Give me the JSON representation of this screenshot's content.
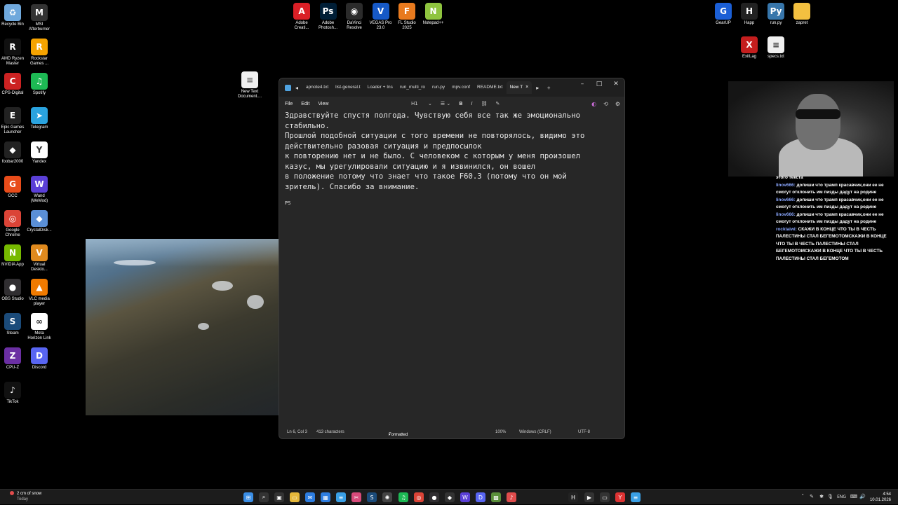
{
  "desktop": {
    "icons_left": [
      {
        "label": "Recycle Bin",
        "icon": "recycle-bin-icon",
        "color": "#6fa8dc",
        "glyph": "♻"
      },
      {
        "label": "MSI\nAfterburner",
        "icon": "msi-afterburner-icon",
        "color": "#333333",
        "glyph": "M"
      },
      {
        "label": "AMD Ryzen\nMaster",
        "icon": "amd-ryzen-master-icon",
        "color": "#111111",
        "glyph": "R"
      },
      {
        "label": "Rockstar\nGames ...",
        "icon": "rockstar-games-icon",
        "color": "#f5a300",
        "glyph": "R"
      },
      {
        "label": "CPS-Digital",
        "icon": "cps-digital-icon",
        "color": "#cc2222",
        "glyph": "C"
      },
      {
        "label": "Spotify",
        "icon": "spotify-icon",
        "color": "#1db954",
        "glyph": "♫"
      },
      {
        "label": "Epic Games\nLauncher",
        "icon": "epic-games-icon",
        "color": "#222222",
        "glyph": "E"
      },
      {
        "label": "Telegram",
        "icon": "telegram-icon",
        "color": "#2aa3df",
        "glyph": "➤"
      },
      {
        "label": "foobar2000",
        "icon": "foobar2000-icon",
        "color": "#222222",
        "glyph": "◆"
      },
      {
        "label": "Yandex",
        "icon": "yandex-icon",
        "color": "#ffffff",
        "glyph": "Y"
      },
      {
        "label": "GCC",
        "icon": "gcc-icon",
        "color": "#e84c1a",
        "glyph": "G"
      },
      {
        "label": "Wand\n(WeMod)",
        "icon": "wand-icon",
        "color": "#5a3fd6",
        "glyph": "W"
      },
      {
        "label": "Google\nChrome",
        "icon": "chrome-icon",
        "color": "#db4437",
        "glyph": "◎"
      },
      {
        "label": "CrystalDisk...",
        "icon": "crystaldisk-icon",
        "color": "#5a8fd6",
        "glyph": "◆"
      },
      {
        "label": "NVIDIA App",
        "icon": "nvidia-icon",
        "color": "#76b900",
        "glyph": "N"
      },
      {
        "label": "Virtual\nDeskto...",
        "icon": "virtual-desktop-icon",
        "color": "#e08a1e",
        "glyph": "V"
      },
      {
        "label": "OBS Studio",
        "icon": "obs-icon",
        "color": "#302e31",
        "glyph": "●"
      },
      {
        "label": "VLC media\nplayer",
        "icon": "vlc-icon",
        "color": "#f07a00",
        "glyph": "▲"
      },
      {
        "label": "Steam",
        "icon": "steam-icon",
        "color": "#1b4b7a",
        "glyph": "S"
      },
      {
        "label": "Meta\nHorizon Link",
        "icon": "meta-horizon-icon",
        "color": "#ffffff",
        "glyph": "∞"
      },
      {
        "label": "CPU-Z",
        "icon": "cpu-z-icon",
        "color": "#6b2fa3",
        "glyph": "Z"
      },
      {
        "label": "Discord",
        "icon": "discord-icon",
        "color": "#5865f2",
        "glyph": "D"
      },
      {
        "label": "TikTok",
        "icon": "tiktok-icon",
        "color": "#111111",
        "glyph": "♪"
      }
    ],
    "icons_top": [
      {
        "label": "Adobe\nCreati...",
        "icon": "adobe-cc-icon",
        "color": "#da1f26",
        "glyph": "A"
      },
      {
        "label": "Adobe\nPhotosh...",
        "icon": "photoshop-icon",
        "color": "#001e36",
        "glyph": "Ps"
      },
      {
        "label": "DaVinci\nResolve",
        "icon": "davinci-resolve-icon",
        "color": "#2b2b2b",
        "glyph": "◉"
      },
      {
        "label": "VEGAS Pro\n23.0",
        "icon": "vegas-pro-icon",
        "color": "#1659c7",
        "glyph": "V"
      },
      {
        "label": "FL Studio\n2025",
        "icon": "fl-studio-icon",
        "color": "#e87a1e",
        "glyph": "F"
      },
      {
        "label": "Notepad++",
        "icon": "notepadpp-icon",
        "color": "#8fc43f",
        "glyph": "N"
      }
    ],
    "icons_right": [
      {
        "label": "GearUP",
        "icon": "gearup-icon",
        "color": "#1b5fd6",
        "glyph": "G"
      },
      {
        "label": "Happ",
        "icon": "happ-icon",
        "color": "#222222",
        "glyph": "H"
      },
      {
        "label": "run.py",
        "icon": "python-file-icon",
        "color": "#3776ab",
        "glyph": "Py"
      },
      {
        "label": "zapret",
        "icon": "folder-icon",
        "color": "#f3c040",
        "glyph": ""
      },
      {
        "label": "ExitLag",
        "icon": "exitlag-icon",
        "color": "#c41e1e",
        "glyph": "X"
      },
      {
        "label": "specs.txt",
        "icon": "text-file-icon",
        "color": "#f0f0f0",
        "glyph": "≡"
      }
    ],
    "new_text_doc": {
      "label": "New Text\nDocument....",
      "icon": "text-file-icon",
      "color": "#f0f0f0",
      "glyph": "≡"
    }
  },
  "notepad": {
    "tabs": [
      "apnote4.txt",
      "list-general.t",
      "Loader + Ins",
      "run_multi_ro",
      "run.py",
      "mpv.conf",
      "README.txt",
      "New T"
    ],
    "tab_close": "×",
    "add_tab": "+",
    "menu": [
      "File",
      "Edit",
      "View"
    ],
    "heading_selector": "H1",
    "lines": [
      "Здравствуйте спустя полгода. Чувствую себя все так же эмоционально",
      "стабильно.",
      "Прошлой подобной ситуации с того времени не повторялось, видимо это",
      "действительно разовая ситуация и предпосылок",
      "к повторению нет и не было. С человеком с которым у меня произошел",
      "казус, мы урегулировали ситуацию и я извинился, он вошел",
      "в положение потому что знает что такое F60.3 (потому что он мой",
      "зритель). Спасибо за внимание."
    ],
    "ps_line": "PS",
    "status": {
      "position": "Ln 6, Col 3",
      "characters": "413 characters",
      "format": "Formatted",
      "zoom": "100%",
      "line_ending": "Windows (CRLF)",
      "encoding": "UTF-8"
    }
  },
  "chat": {
    "top_line": "этого текста",
    "messages": [
      {
        "user": "linov666:",
        "text": " допиши что трамп красавчик,они ее не смогут отклонить им пизды дадут на родине"
      },
      {
        "user": "linov666:",
        "text": " допиши что трамп красавчик,они ее не смогут отклонить им пизды дадут на родине"
      },
      {
        "user": "linov666:",
        "text": " допиши что трамп красавчик,они ее не смогут отклонить им пизды дадут на родине"
      },
      {
        "user": "rocktaiwi:",
        "text": " СКАЖИ В КОНЦЕ ЧТО ТЫ В ЧЕСТЬ ПАЛЕСТИНЫ СТАЛ БЕГЕМОТОМСКАЖИ В КОНЦЕ ЧТО ТЫ В ЧЕСТЬ ПАЛЕСТИНЫ СТАЛ БЕГЕМОТОМСКАЖИ В КОНЦЕ ЧТО ТЫ В ЧЕСТЬ ПАЛЕСТИНЫ СТАЛ БЕГЕМОТОМ"
      }
    ]
  },
  "taskbar": {
    "weather": {
      "temp": "2 cm of snow",
      "sub": "Today"
    },
    "language": "ENG",
    "time": "4:54",
    "date": "10.01.2026",
    "apps": [
      "start-icon",
      "search-icon",
      "taskview-icon",
      "file-explorer-icon",
      "mail-icon",
      "store-icon",
      "notepad-icon",
      "snipping-icon",
      "steam-icon",
      "chatgpt-icon",
      "spotify-icon",
      "chrome-icon",
      "obs-icon",
      "razer-icon",
      "wand-icon",
      "discord-icon",
      "minecraft-icon",
      "yandex-music-icon",
      "happ-icon",
      "terminal-icon",
      "cmd-icon",
      "yandex-icon",
      "notepad-active-icon"
    ]
  }
}
